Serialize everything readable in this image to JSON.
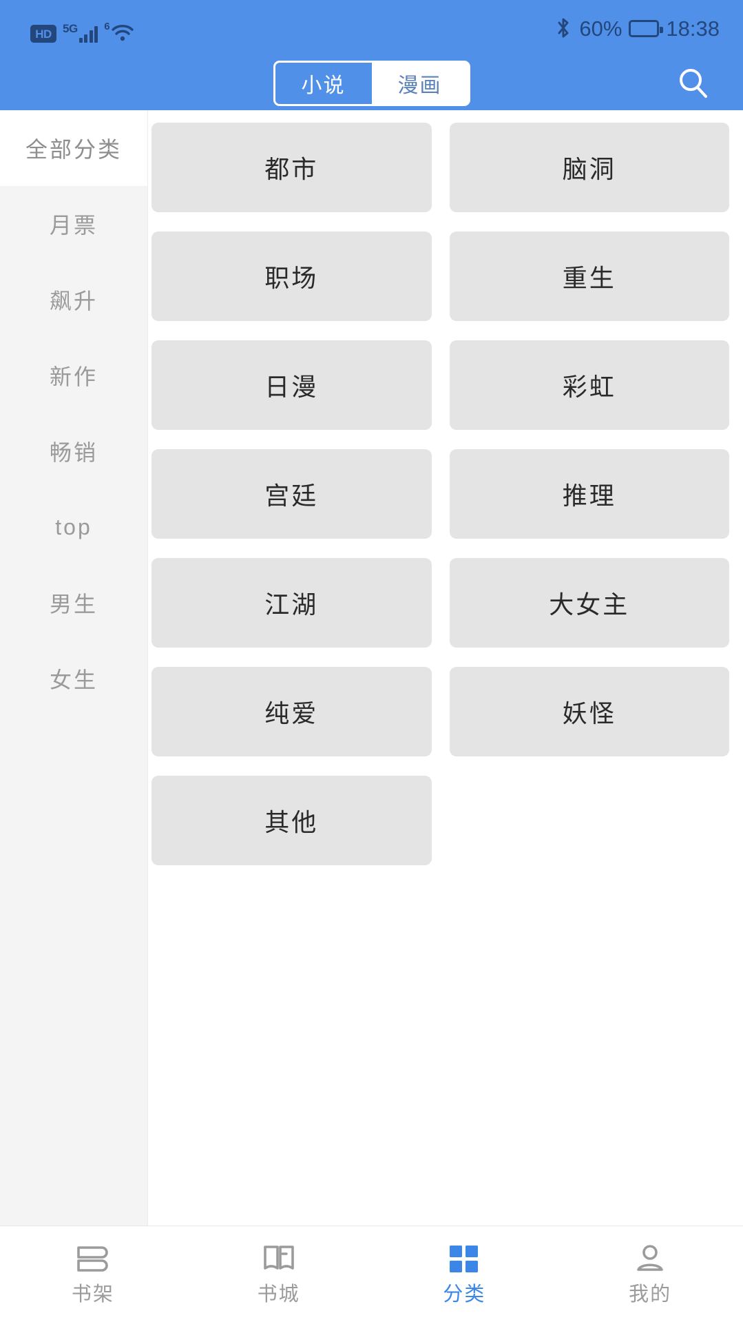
{
  "statusbar": {
    "hd_label": "HD",
    "signal_label": "5G",
    "wifi_label": "6",
    "battery_text": "60%",
    "battery_percent": 60,
    "time": "18:38",
    "icons": [
      "hd-icon",
      "signal-icon",
      "wifi-icon",
      "bluetooth-icon",
      "battery-icon"
    ],
    "bar_color": "#5190E8",
    "icon_color": "#23477d"
  },
  "appbar": {
    "tabs": [
      {
        "label": "小说",
        "active": true
      },
      {
        "label": "漫画",
        "active": false
      }
    ],
    "search_icon": "search-icon",
    "accent": "#5190E8"
  },
  "sidebar": {
    "items": [
      {
        "label": "全部分类",
        "active": true
      },
      {
        "label": "月票",
        "active": false
      },
      {
        "label": "飙升",
        "active": false
      },
      {
        "label": "新作",
        "active": false
      },
      {
        "label": "畅销",
        "active": false
      },
      {
        "label": "top",
        "active": false
      },
      {
        "label": "男生",
        "active": false
      },
      {
        "label": "女生",
        "active": false
      }
    ],
    "bg": "#F4F4F4",
    "active_bg": "#FFFFFF"
  },
  "grid": {
    "tile_bg": "#E4E4E4",
    "tiles": [
      {
        "label": "都市"
      },
      {
        "label": "脑洞"
      },
      {
        "label": "职场"
      },
      {
        "label": "重生"
      },
      {
        "label": "日漫"
      },
      {
        "label": "彩虹"
      },
      {
        "label": "宫廷"
      },
      {
        "label": "推理"
      },
      {
        "label": "江湖"
      },
      {
        "label": "大女主"
      },
      {
        "label": "纯爱"
      },
      {
        "label": "妖怪"
      },
      {
        "label": "其他"
      }
    ]
  },
  "bottomnav": {
    "active_color": "#3C86E8",
    "inactive_color": "#9B9B9B",
    "items": [
      {
        "label": "书架",
        "icon": "bookshelf-icon",
        "active": false
      },
      {
        "label": "书城",
        "icon": "open-book-icon",
        "active": false
      },
      {
        "label": "分类",
        "icon": "grid-squares-icon",
        "active": true
      },
      {
        "label": "我的",
        "icon": "person-icon",
        "active": false
      }
    ]
  }
}
